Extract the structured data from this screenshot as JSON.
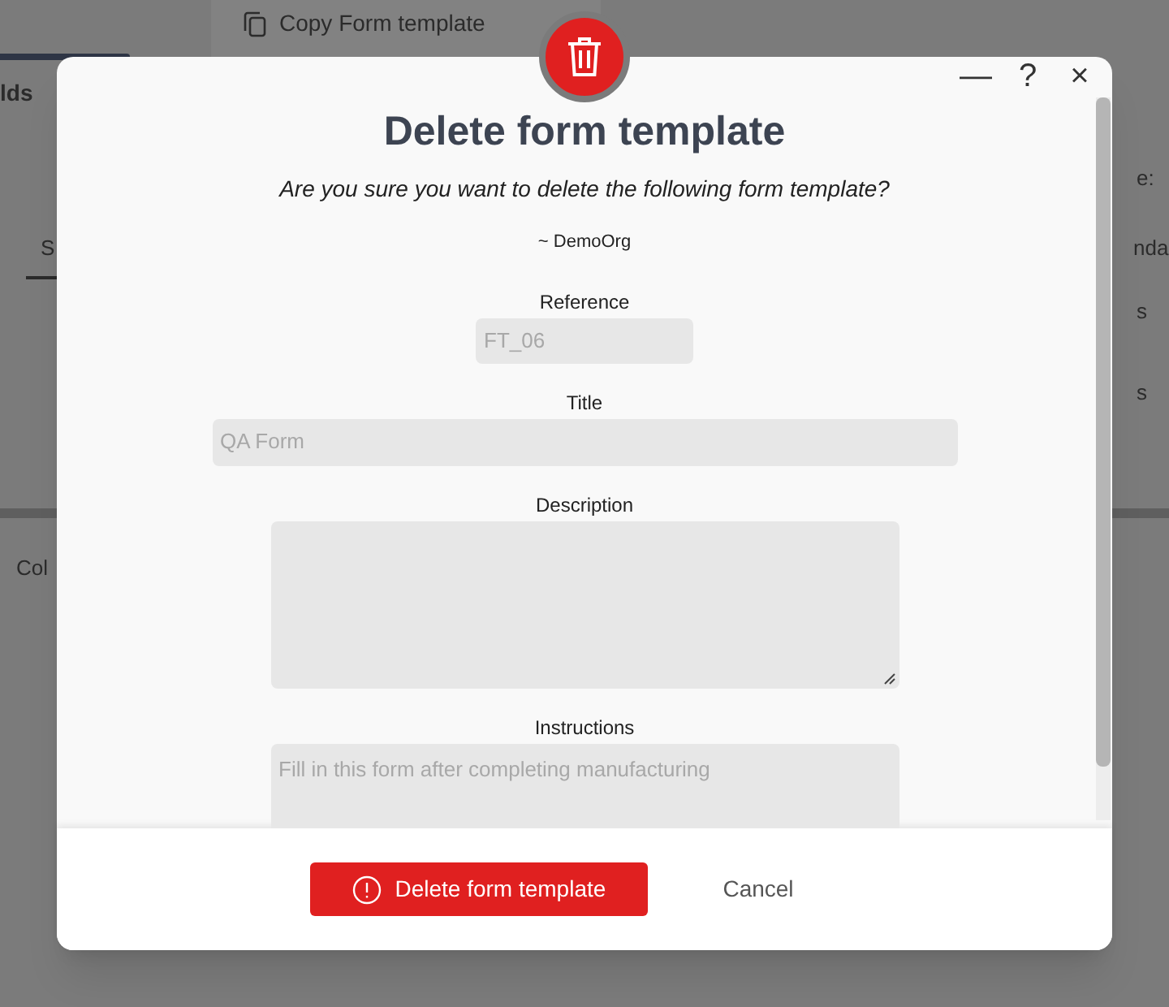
{
  "background": {
    "menu_item": "Copy Form template",
    "fragments": [
      {
        "kind": "tab",
        "text": "lds"
      },
      {
        "kind": "label",
        "text": "S"
      },
      {
        "kind": "label",
        "text": "e:"
      },
      {
        "kind": "label",
        "text": "nda"
      },
      {
        "kind": "label",
        "text": "s"
      },
      {
        "kind": "label",
        "text": "s"
      },
      {
        "kind": "label",
        "text": "Col"
      }
    ]
  },
  "dialog": {
    "title": "Delete form template",
    "controls": [
      "—",
      "?",
      "×"
    ],
    "question": "Are you sure you want to delete the following form template?",
    "organisation": "~ DemoOrg",
    "fields": [
      {
        "label": "Reference",
        "value": "FT_06",
        "kind": "short",
        "disabled": true
      },
      {
        "label": "Title",
        "value": "QA Form",
        "kind": "wide",
        "disabled": true
      },
      {
        "label": "Description",
        "kind": "area",
        "disabled": true
      },
      {
        "label": "Instructions",
        "value": "Fill in this form after completing manufacturing",
        "kind": "area_cut",
        "disabled": true
      }
    ],
    "buttons": [
      {
        "label": "Delete form template",
        "kind": "danger"
      },
      {
        "label": "Cancel",
        "kind": "plain"
      }
    ]
  }
}
